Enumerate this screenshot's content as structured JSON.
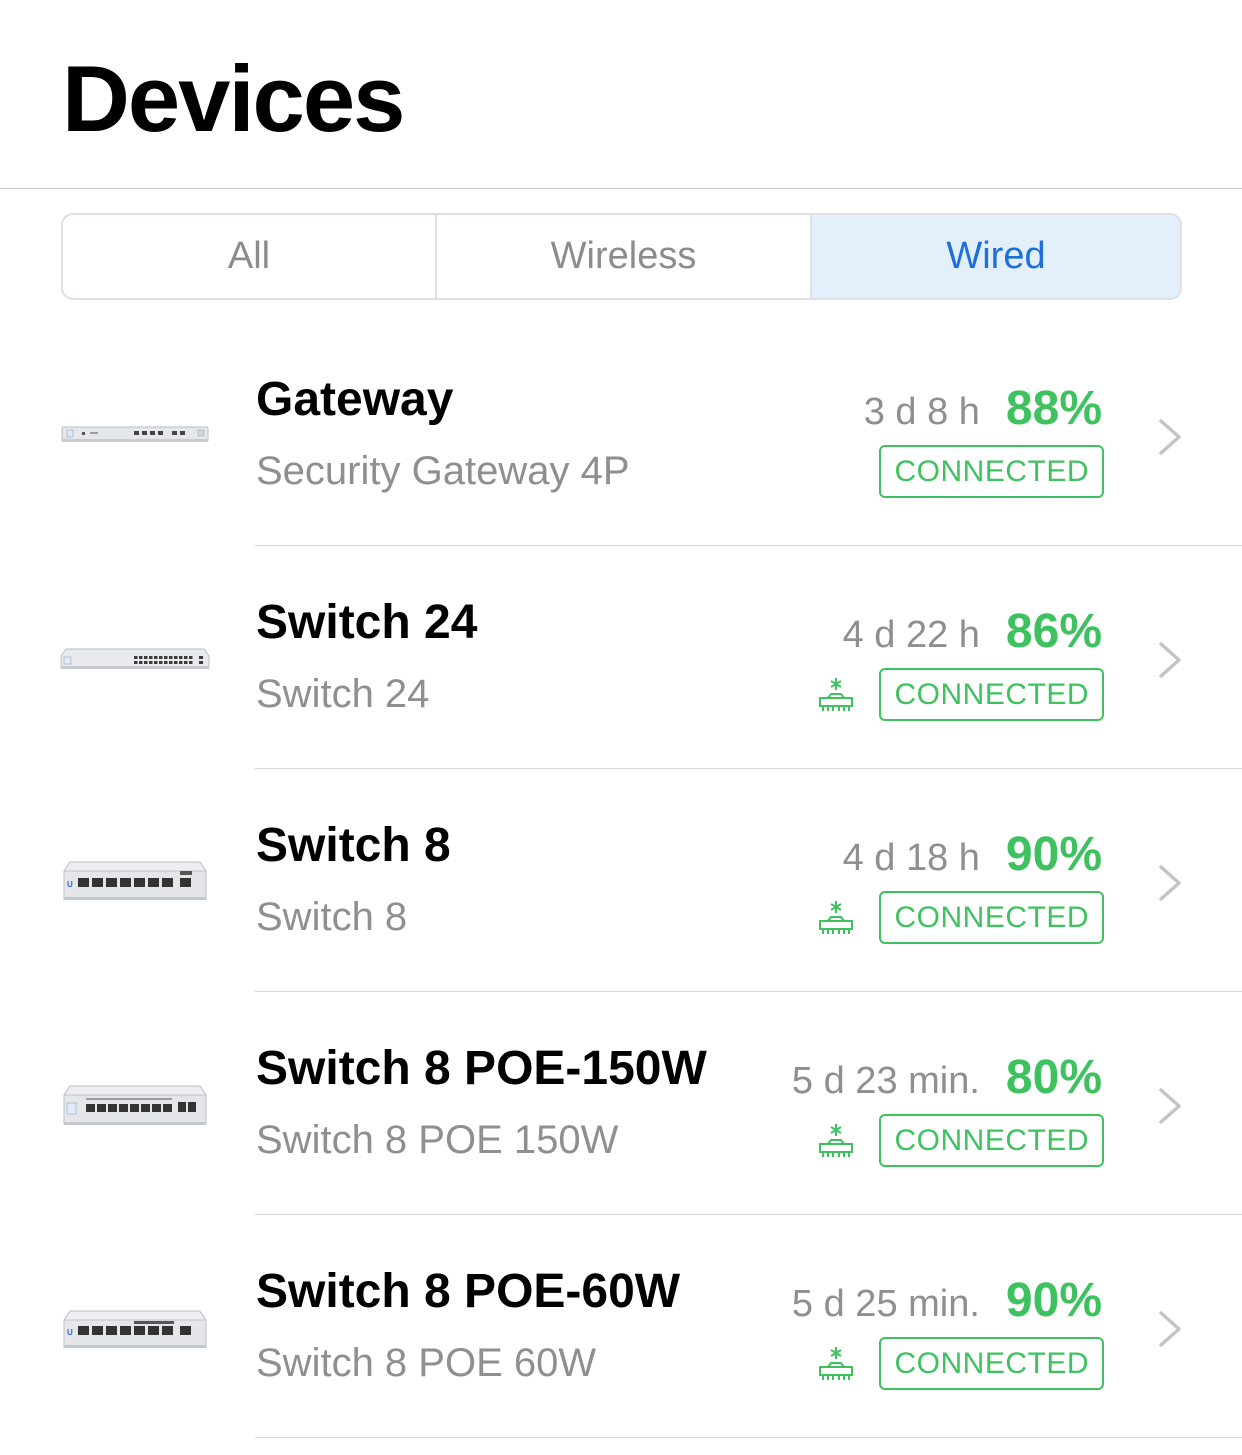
{
  "header": {
    "title": "Devices"
  },
  "filter": {
    "tabs": [
      {
        "label": "All",
        "active": false
      },
      {
        "label": "Wireless",
        "active": false
      },
      {
        "label": "Wired",
        "active": true
      }
    ]
  },
  "colors": {
    "accent": "#1d6fd9",
    "status_green": "#3ec15f",
    "secondary_text": "#8e8e93"
  },
  "devices": [
    {
      "name": "Gateway",
      "model": "Security Gateway 4P",
      "uptime": "3 d 8 h",
      "percent": "88%",
      "status": "CONNECTED",
      "thumb_icon": "gateway-device-image",
      "uplink_icon": null
    },
    {
      "name": "Switch 24",
      "model": "Switch 24",
      "uptime": "4 d 22 h",
      "percent": "86%",
      "status": "CONNECTED",
      "thumb_icon": "switch-24-device-image",
      "uplink_icon": "uplink-icon"
    },
    {
      "name": "Switch 8",
      "model": "Switch 8",
      "uptime": "4 d 18 h",
      "percent": "90%",
      "status": "CONNECTED",
      "thumb_icon": "switch-8-device-image",
      "uplink_icon": "uplink-icon"
    },
    {
      "name": "Switch 8 POE-150W",
      "model": "Switch 8 POE 150W",
      "uptime": "5 d 23 min.",
      "percent": "80%",
      "status": "CONNECTED",
      "thumb_icon": "switch-8-poe-150w-device-image",
      "uplink_icon": "uplink-icon"
    },
    {
      "name": "Switch 8 POE-60W",
      "model": "Switch 8 POE 60W",
      "uptime": "5 d 25 min.",
      "percent": "90%",
      "status": "CONNECTED",
      "thumb_icon": "switch-8-poe-60w-device-image",
      "uplink_icon": "uplink-icon"
    }
  ]
}
